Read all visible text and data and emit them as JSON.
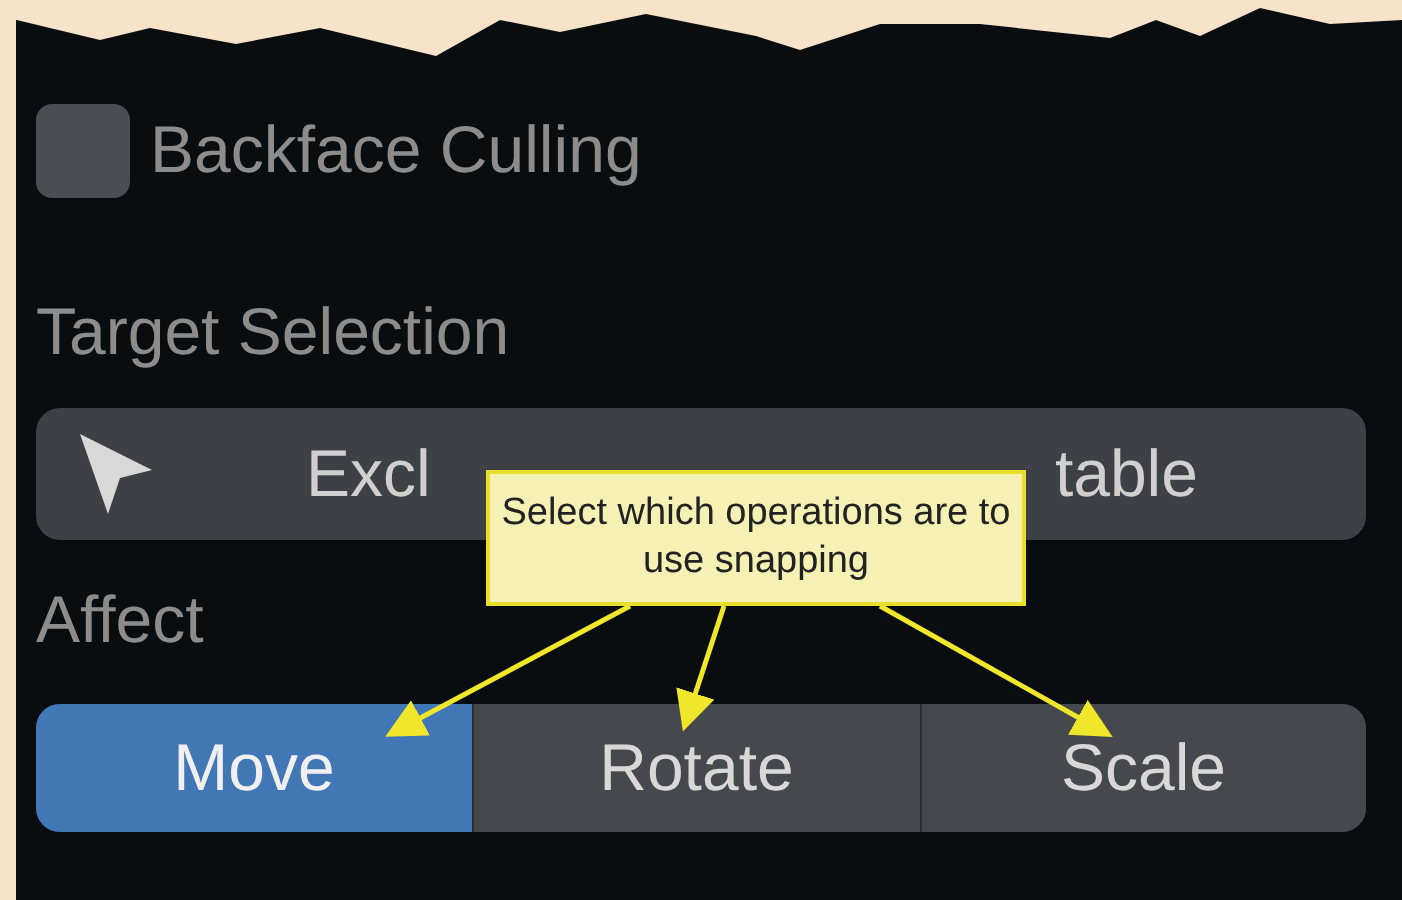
{
  "options": [
    {
      "kind": "checkbox",
      "label": "Backface Culling",
      "checked": false
    }
  ],
  "target_selection": {
    "heading": "Target Selection",
    "dropdown": {
      "text_left": "Excl",
      "text_right": "table"
    }
  },
  "affect": {
    "heading": "Affect",
    "segments": [
      {
        "label": "Move",
        "selected": true
      },
      {
        "label": "Rotate",
        "selected": false
      },
      {
        "label": "Scale",
        "selected": false
      }
    ]
  },
  "callout": {
    "text": "Select which operations are to use snapping"
  }
}
